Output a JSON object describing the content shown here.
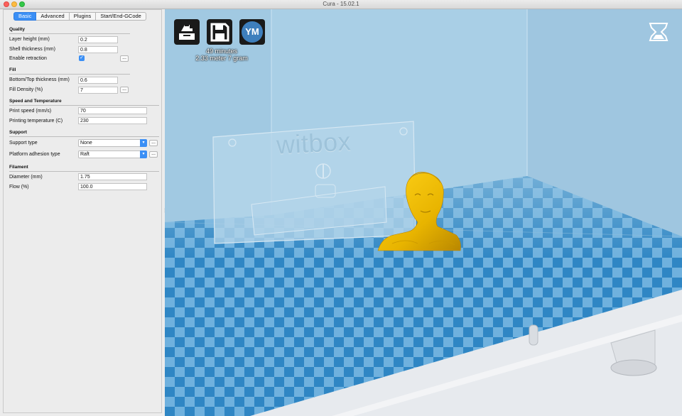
{
  "window": {
    "title": "Cura - 15.02.1"
  },
  "tabs": [
    "Basic",
    "Advanced",
    "Plugins",
    "Start/End-GCode"
  ],
  "sections": {
    "quality": "Quality",
    "fill": "Fill",
    "speed": "Speed and Temperature",
    "support": "Support",
    "filament": "Filament"
  },
  "settings": {
    "layer_height": {
      "label": "Layer height (mm)",
      "value": "0.2"
    },
    "shell_thickness": {
      "label": "Shell thickness (mm)",
      "value": "0.8"
    },
    "retraction": {
      "label": "Enable retraction",
      "checked": true
    },
    "bottom_top": {
      "label": "Bottom/Top thickness (mm)",
      "value": "0.6"
    },
    "fill_density": {
      "label": "Fill Density (%)",
      "value": "7"
    },
    "print_speed": {
      "label": "Print speed (mm/s)",
      "value": "70"
    },
    "print_temp": {
      "label": "Printing temperature (C)",
      "value": "230"
    },
    "support_type": {
      "label": "Support type",
      "value": "None"
    },
    "adhesion": {
      "label": "Platform adhesion type",
      "value": "Raft"
    },
    "diameter": {
      "label": "Diameter (mm)",
      "value": "1.75"
    },
    "flow": {
      "label": "Flow (%)",
      "value": "100.0"
    }
  },
  "ellipsis": "...",
  "print_info": {
    "time": "49 minutes",
    "material": "2.33 meter 7 gram"
  },
  "toolbar": {
    "ym_label": "YM"
  },
  "scene": {
    "backplate_text": "witbox"
  },
  "colors": {
    "accent": "#3b8ff5",
    "bed_dark": "#2f86c4",
    "bed_light": "#6fb1de",
    "model": "#e8b400"
  },
  "icons": [
    "load-model-icon",
    "save-gcode-icon",
    "youmagine-icon",
    "view-mode-icon",
    "checkmark-icon",
    "chevron-down-icon"
  ]
}
